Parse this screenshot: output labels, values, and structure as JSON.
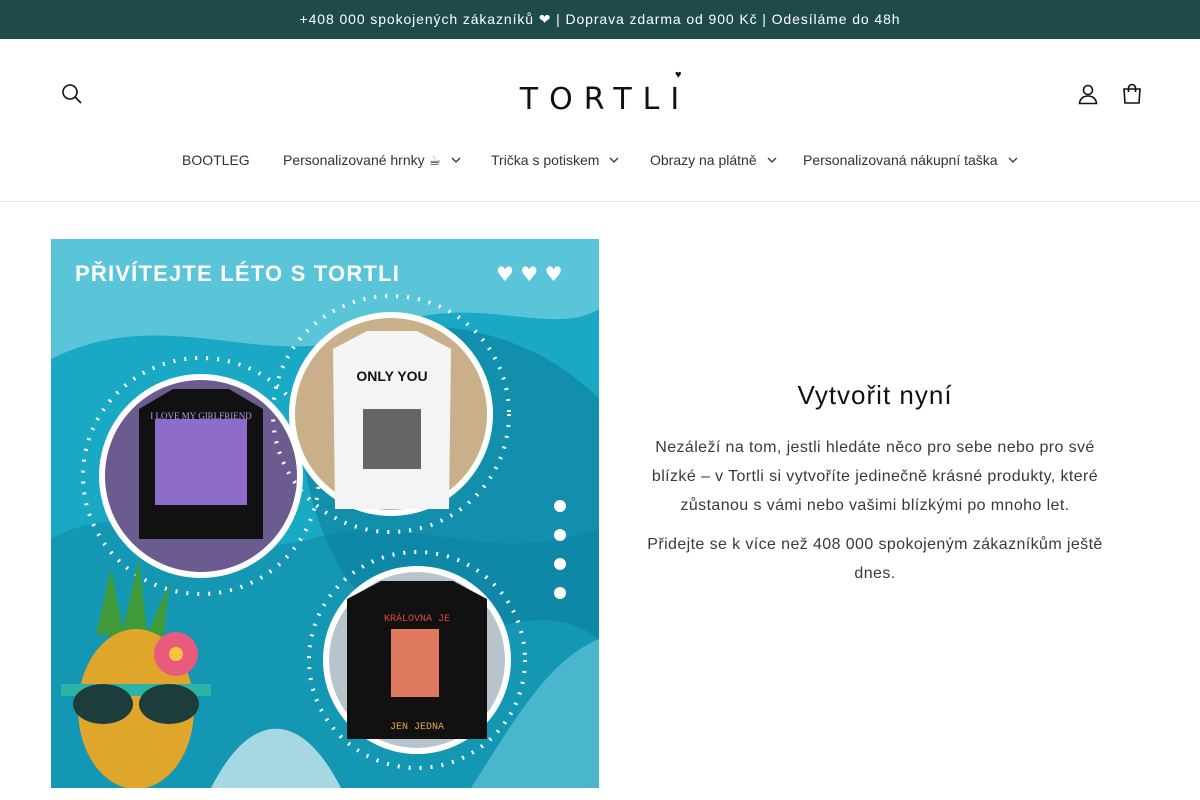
{
  "announcement": {
    "text": "+408 000 spokojených zákazníků ❤ | Doprava zdarma od 900 Kč | Odesíláme do 48h"
  },
  "header": {
    "logo_text": "TORTLI",
    "icons": {
      "search": "search-icon",
      "account": "user-icon",
      "cart": "cart-icon"
    }
  },
  "nav": {
    "items": [
      {
        "label": "BOOTLEG",
        "has_dropdown": false
      },
      {
        "label": "Personalizované hrnky ☕",
        "has_dropdown": true
      },
      {
        "label": "Trička s potiskem",
        "has_dropdown": true
      },
      {
        "label": "Obrazy na plátně",
        "has_dropdown": true
      },
      {
        "label": "Personalizovaná nákupní taška",
        "has_dropdown": true
      }
    ]
  },
  "hero": {
    "banner_title": "PŘIVÍTEJTE LÉTO S TORTLI",
    "shirt_1_text": "I LOVE MY GIRLFRIEND",
    "shirt_2_text": "ONLY YOU",
    "shirt_3_top": "KRÁLOVNA JE",
    "shirt_3_bottom": "JEN JEDNA",
    "heading": "Vytvořit nyní",
    "paragraph_1": "Nezáleží na tom, jestli hledáte něco pro sebe nebo pro své blízké – v Tortli si vytvoříte jedinečně krásné produkty, které zůstanou s vámi nebo vašimi blízkými po mnoho let.",
    "paragraph_2": "Přidejte se k více než 408 000 spokojeným zákazníkům ještě dnes."
  },
  "colors": {
    "announcement_bg": "#1e4a4a",
    "banner_blue": "#1aa6c0",
    "text": "#121212"
  }
}
